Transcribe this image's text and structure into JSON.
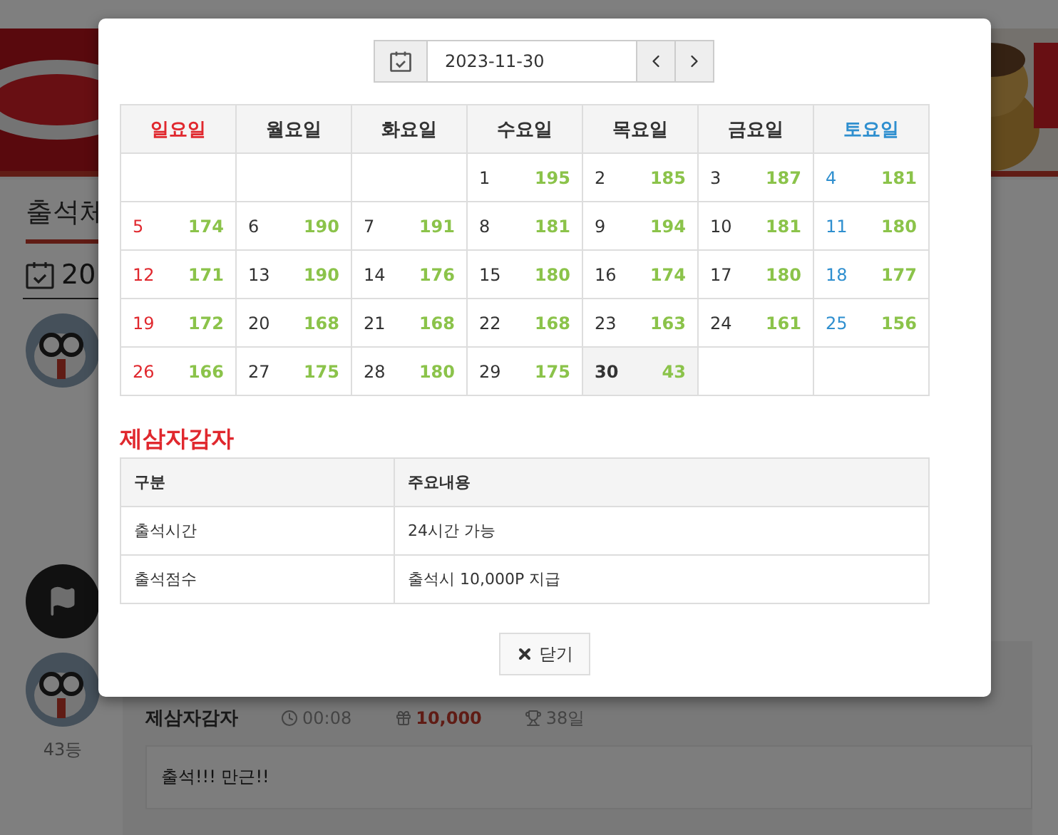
{
  "page": {
    "tab_title": "출석체",
    "date_heading": "20",
    "comment": {
      "rank": "43등",
      "author": "제삼자감자",
      "time": "00:08",
      "points": "10,000",
      "streak": "38일",
      "message": "출석!!! 만근!!"
    }
  },
  "modal": {
    "date": "2023-11-30",
    "weekdays": [
      "일요일",
      "월요일",
      "화요일",
      "수요일",
      "목요일",
      "금요일",
      "토요일"
    ],
    "weeks": [
      [
        {
          "day": "1",
          "count": "195",
          "selected": false
        },
        {
          "day": "2",
          "count": "185",
          "selected": false
        },
        {
          "day": "3",
          "count": "187",
          "selected": false
        },
        {
          "day": "4",
          "count": "181",
          "selected": false
        }
      ],
      [
        {
          "day": "5",
          "count": "174",
          "selected": false
        },
        {
          "day": "6",
          "count": "190",
          "selected": false
        },
        {
          "day": "7",
          "count": "191",
          "selected": false
        },
        {
          "day": "8",
          "count": "181",
          "selected": false
        },
        {
          "day": "9",
          "count": "194",
          "selected": false
        },
        {
          "day": "10",
          "count": "181",
          "selected": false
        },
        {
          "day": "11",
          "count": "180",
          "selected": false
        }
      ],
      [
        {
          "day": "12",
          "count": "171",
          "selected": false
        },
        {
          "day": "13",
          "count": "190",
          "selected": false
        },
        {
          "day": "14",
          "count": "176",
          "selected": false
        },
        {
          "day": "15",
          "count": "180",
          "selected": false
        },
        {
          "day": "16",
          "count": "174",
          "selected": false
        },
        {
          "day": "17",
          "count": "180",
          "selected": false
        },
        {
          "day": "18",
          "count": "177",
          "selected": false
        }
      ],
      [
        {
          "day": "19",
          "count": "172",
          "selected": false
        },
        {
          "day": "20",
          "count": "168",
          "selected": false
        },
        {
          "day": "21",
          "count": "168",
          "selected": false
        },
        {
          "day": "22",
          "count": "168",
          "selected": false
        },
        {
          "day": "23",
          "count": "163",
          "selected": false
        },
        {
          "day": "24",
          "count": "161",
          "selected": false
        },
        {
          "day": "25",
          "count": "156",
          "selected": false
        }
      ],
      [
        {
          "day": "26",
          "count": "166",
          "selected": false
        },
        {
          "day": "27",
          "count": "175",
          "selected": false
        },
        {
          "day": "28",
          "count": "180",
          "selected": false
        },
        {
          "day": "29",
          "count": "175",
          "selected": false
        },
        {
          "day": "30",
          "count": "43",
          "selected": true
        }
      ]
    ],
    "user_title": "제삼자감자",
    "info_table": {
      "columns": [
        "구분",
        "주요내용"
      ],
      "rows": [
        [
          "출석시간",
          "24시간 가능"
        ],
        [
          "출석점수",
          "출석시 10,000P 지급"
        ]
      ]
    },
    "close_label": "닫기"
  }
}
